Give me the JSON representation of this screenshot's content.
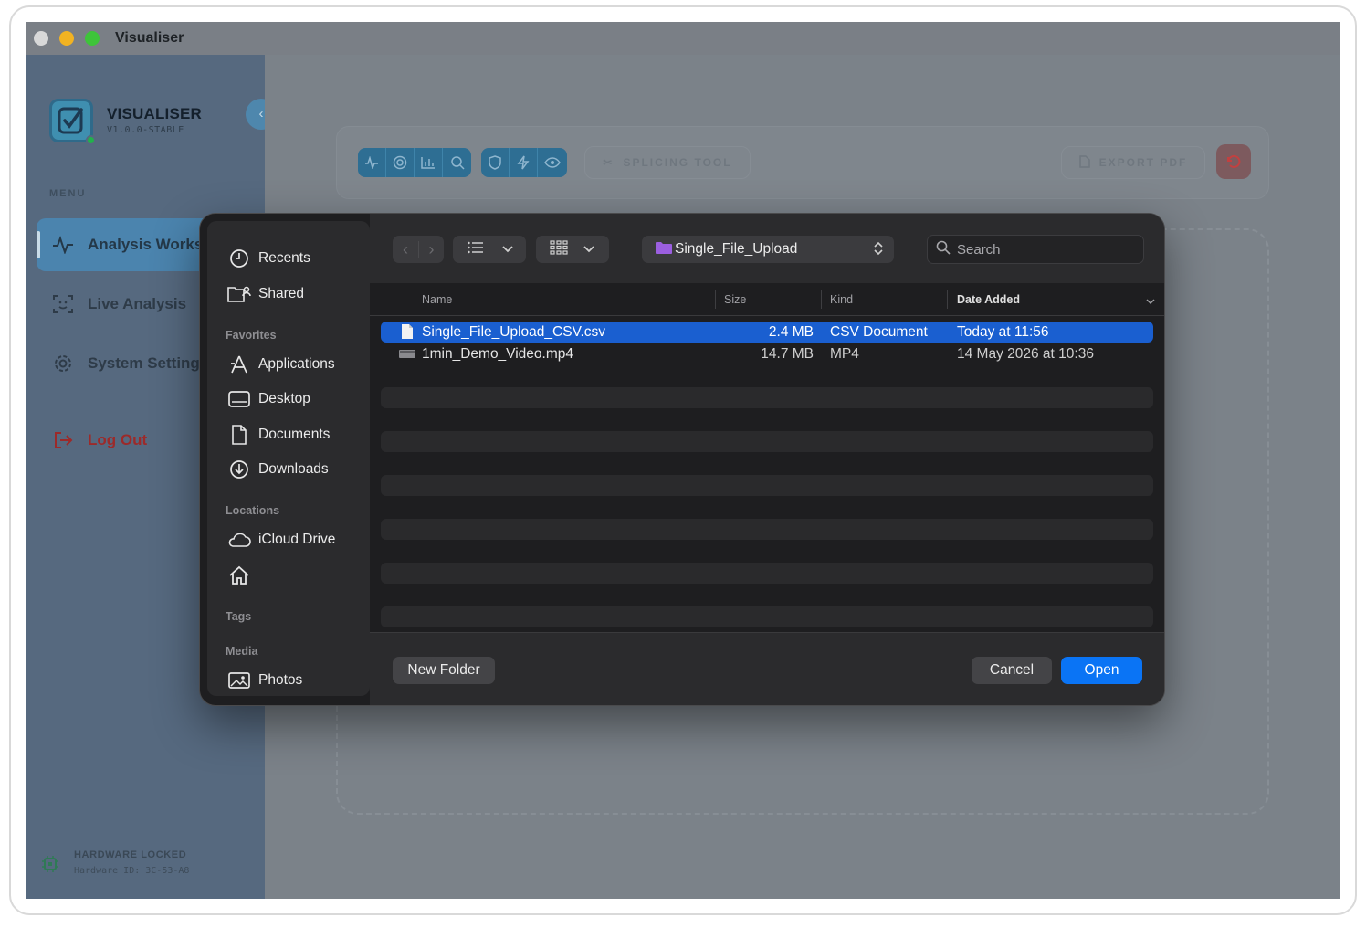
{
  "window": {
    "title": "Visualiser"
  },
  "app": {
    "brand": "VISUALISER",
    "version": "V1.0.0-STABLE",
    "menu_label": "MENU",
    "nav": [
      {
        "label": "Analysis Workspace",
        "icon": "activity-icon"
      },
      {
        "label": "Live Analysis",
        "icon": "scan-face-icon"
      },
      {
        "label": "System Settings",
        "icon": "gear-icon"
      },
      {
        "label": "Log Out",
        "icon": "logout-icon"
      }
    ],
    "hardware": {
      "title": "HARDWARE LOCKED",
      "id": "Hardware ID: 3C-53-A8"
    },
    "toolbar": {
      "splicing_label": "SPLICING TOOL",
      "export_label": "EXPORT PDF"
    }
  },
  "dialog": {
    "sidebar": {
      "top_items": [
        "Recents",
        "Shared"
      ],
      "favorites_heading": "Favorites",
      "favorites": [
        "Applications",
        "Desktop",
        "Documents",
        "Downloads"
      ],
      "locations_heading": "Locations",
      "locations": [
        "iCloud Drive"
      ],
      "tags_heading": "Tags",
      "media_heading": "Media",
      "media": [
        "Photos"
      ]
    },
    "path": "Single_File_Upload",
    "search_placeholder": "Search",
    "columns": {
      "name": "Name",
      "size": "Size",
      "kind": "Kind",
      "date": "Date Added"
    },
    "files": [
      {
        "name": "Single_File_Upload_CSV.csv",
        "size": "2.4 MB",
        "kind": "CSV Document",
        "date": "Today at 11:56",
        "selected": true
      },
      {
        "name": "1min_Demo_Video.mp4",
        "size": "14.7 MB",
        "kind": "MP4",
        "date": "14 May 2026 at 10:36",
        "selected": false
      }
    ],
    "new_folder_label": "New Folder",
    "cancel_label": "Cancel",
    "open_label": "Open"
  },
  "colors": {
    "accent": "#0a74f5",
    "selection": "#1a5fd0",
    "logout": "#9c2a2a"
  }
}
